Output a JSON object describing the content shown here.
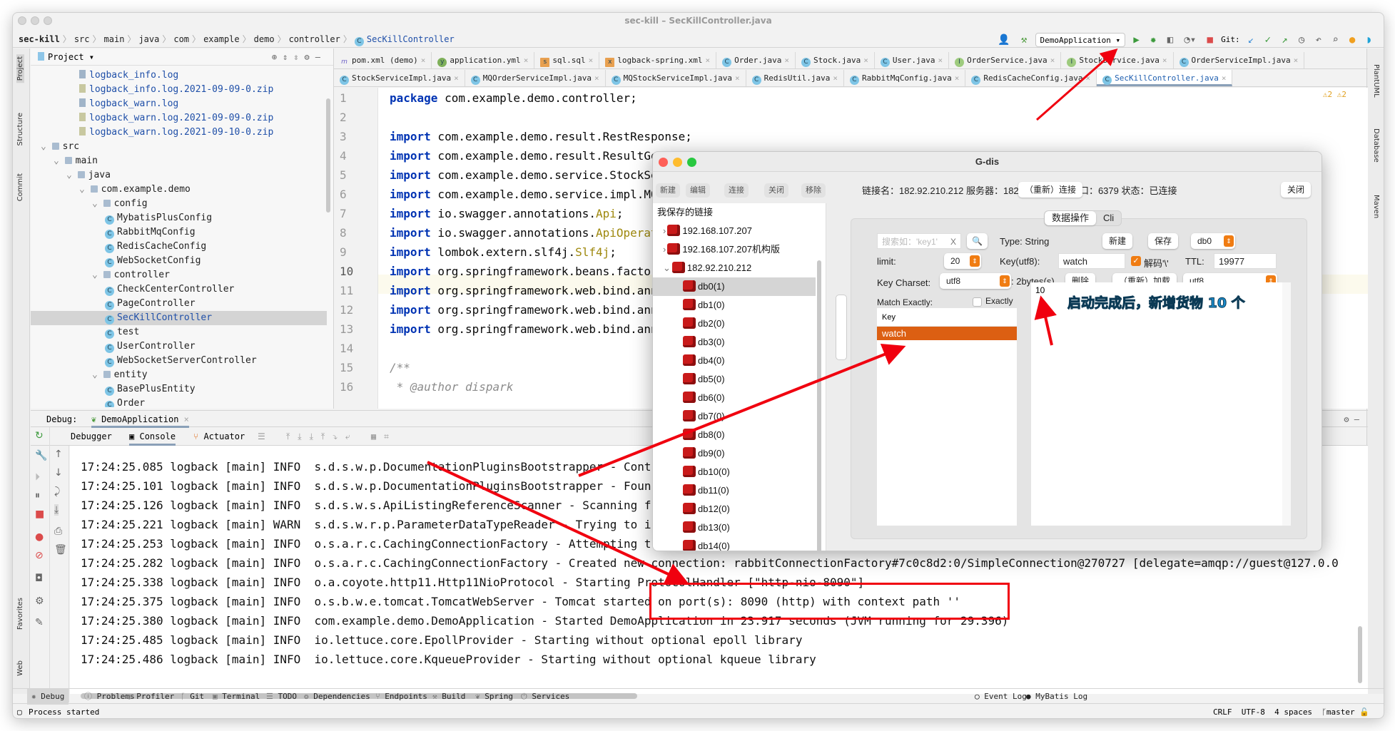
{
  "window": {
    "title": "sec-kill – SecKillController.java"
  },
  "breadcrumb": [
    "sec-kill",
    "src",
    "main",
    "java",
    "com",
    "example",
    "demo",
    "controller",
    "SecKillController"
  ],
  "toolbar": {
    "run_config": "DemoApplication",
    "git_label": "Git:"
  },
  "project": {
    "header": "Project",
    "tree": [
      {
        "label": "logback_info.log",
        "indent": 4,
        "type": "log",
        "link": true
      },
      {
        "label": "logback_info.log.2021-09-09-0.zip",
        "indent": 4,
        "type": "zip",
        "link": true
      },
      {
        "label": "logback_warn.log",
        "indent": 4,
        "type": "log",
        "link": true
      },
      {
        "label": "logback_warn.log.2021-09-09-0.zip",
        "indent": 4,
        "type": "zip",
        "link": true
      },
      {
        "label": "logback_warn.log.2021-09-10-0.zip",
        "indent": 4,
        "type": "zip",
        "link": true
      },
      {
        "label": "src",
        "indent": 1,
        "type": "folder",
        "arrow": "v"
      },
      {
        "label": "main",
        "indent": 2,
        "type": "folder",
        "arrow": "v"
      },
      {
        "label": "java",
        "indent": 3,
        "type": "folder",
        "arrow": "v"
      },
      {
        "label": "com.example.demo",
        "indent": 4,
        "type": "folder",
        "arrow": "v"
      },
      {
        "label": "config",
        "indent": 5,
        "type": "folder",
        "arrow": "v"
      },
      {
        "label": "MybatisPlusConfig",
        "indent": 6,
        "type": "class"
      },
      {
        "label": "RabbitMqConfig",
        "indent": 6,
        "type": "class"
      },
      {
        "label": "RedisCacheConfig",
        "indent": 6,
        "type": "class"
      },
      {
        "label": "WebSocketConfig",
        "indent": 6,
        "type": "class"
      },
      {
        "label": "controller",
        "indent": 5,
        "type": "folder",
        "arrow": "v"
      },
      {
        "label": "CheckCenterController",
        "indent": 6,
        "type": "class"
      },
      {
        "label": "PageController",
        "indent": 6,
        "type": "class"
      },
      {
        "label": "SecKillController",
        "indent": 6,
        "type": "class",
        "selected": true
      },
      {
        "label": "test",
        "indent": 6,
        "type": "class"
      },
      {
        "label": "UserController",
        "indent": 6,
        "type": "class"
      },
      {
        "label": "WebSocketServerController",
        "indent": 6,
        "type": "class"
      },
      {
        "label": "entity",
        "indent": 5,
        "type": "folder",
        "arrow": "v"
      },
      {
        "label": "BasePlusEntity",
        "indent": 6,
        "type": "class"
      },
      {
        "label": "Order",
        "indent": 6,
        "type": "class"
      }
    ]
  },
  "tabs_row1": [
    {
      "label": "pom.xml (demo)",
      "icon": "m"
    },
    {
      "label": "application.yml",
      "icon": "y"
    },
    {
      "label": "sql.sql",
      "icon": "s"
    },
    {
      "label": "logback-spring.xml",
      "icon": "x"
    },
    {
      "label": "Order.java",
      "icon": "C"
    },
    {
      "label": "Stock.java",
      "icon": "C"
    },
    {
      "label": "User.java",
      "icon": "C"
    },
    {
      "label": "OrderService.java",
      "icon": "I"
    },
    {
      "label": "StockService.java",
      "icon": "I"
    },
    {
      "label": "OrderServiceImpl.java",
      "icon": "C"
    }
  ],
  "tabs_row2": [
    {
      "label": "StockServiceImpl.java",
      "icon": "C"
    },
    {
      "label": "MQOrderServiceImpl.java",
      "icon": "C"
    },
    {
      "label": "MQStockServiceImpl.java",
      "icon": "C"
    },
    {
      "label": "RedisUtil.java",
      "icon": "C"
    },
    {
      "label": "RabbitMqConfig.java",
      "icon": "C"
    },
    {
      "label": "RedisCacheConfig.java",
      "icon": "C"
    },
    {
      "label": "SecKillController.java",
      "icon": "C",
      "active": true
    }
  ],
  "editor": {
    "warnings": "⚠2  ⚠2",
    "lines": [
      {
        "n": "1",
        "kw": "package",
        "rest": " com.example.demo.controller;"
      },
      {
        "n": "2",
        "kw": "",
        "rest": ""
      },
      {
        "n": "3",
        "kw": "import",
        "rest": " com.example.demo.result.RestResponse;"
      },
      {
        "n": "4",
        "kw": "import",
        "rest": " com.example.demo.result.ResultGen"
      },
      {
        "n": "5",
        "kw": "import",
        "rest": " com.example.demo.service.StockSer"
      },
      {
        "n": "6",
        "kw": "import",
        "rest": " com.example.demo.service.impl.MQS"
      },
      {
        "n": "7",
        "kw": "import",
        "rest": " io.swagger.annotations.",
        "ann": "Api",
        "tail": ";"
      },
      {
        "n": "8",
        "kw": "import",
        "rest": " io.swagger.annotations.",
        "ann": "ApiOperati"
      },
      {
        "n": "9",
        "kw": "import",
        "rest": " lombok.extern.slf4j.",
        "ann": "Slf4j",
        "tail": ";"
      },
      {
        "n": "10",
        "kw": "import",
        "rest": " org.springframework.beans.factory"
      },
      {
        "n": "11",
        "kw": "import",
        "rest": " org.springframework.web.bind.anno"
      },
      {
        "n": "12",
        "kw": "import",
        "rest": " org.springframework.web.bind.anno"
      },
      {
        "n": "13",
        "kw": "import",
        "rest": " org.springframework.web.bind.anno"
      },
      {
        "n": "14",
        "kw": "",
        "rest": ""
      },
      {
        "n": "15",
        "kw": "",
        "rest": "",
        "cmt": "/**"
      },
      {
        "n": "16",
        "kw": "",
        "rest": "",
        "cmt": " * @author dispark"
      }
    ]
  },
  "debug": {
    "label": "Debug:",
    "session": "DemoApplication",
    "tabs": [
      "Debugger",
      "Console",
      "Actuator"
    ]
  },
  "console": [
    "17:24:25.085 logback [main] INFO  s.d.s.w.p.DocumentationPluginsBootstrapper - Cont",
    "17:24:25.101 logback [main] INFO  s.d.s.w.p.DocumentationPluginsBootstrapper - Foun",
    "17:24:25.126 logback [main] INFO  s.d.s.w.s.ApiListingReferenceScanner - Scanning f",
    "17:24:25.221 logback [main] WARN  s.d.s.w.r.p.ParameterDataTypeReader - Trying to i",
    "17:24:25.253 logback [main] INFO  o.s.a.r.c.CachingConnectionFactory - Attempting t",
    "17:24:25.282 logback [main] INFO  o.s.a.r.c.CachingConnectionFactory - Created new connection: rabbitConnectionFactory#7c0c8d2:0/SimpleConnection@270727 [delegate=amqp://guest@127.0.0",
    "17:24:25.338 logback [main] INFO  o.a.coyote.http11.Http11NioProtocol - Starting ProtocolHandler [\"http-nio-8090\"]",
    "17:24:25.375 logback [main] INFO  o.s.b.w.e.tomcat.TomcatWebServer - Tomcat started on port(s): 8090 (http) with context path ''",
    "17:24:25.380 logback [main] INFO  com.example.demo.DemoApplication - Started DemoApplication in 23.917 seconds (JVM running for 29.396)",
    "17:24:25.485 logback [main] INFO  io.lettuce.core.EpollProvider - Starting without optional epoll library",
    "17:24:25.486 logback [main] INFO  io.lettuce.core.KqueueProvider - Starting without optional kqueue library"
  ],
  "bottom_tools": [
    "Debug",
    "Problems",
    "Profiler",
    "Git",
    "Terminal",
    "TODO",
    "Dependencies",
    "Endpoints",
    "Build",
    "Spring",
    "Services"
  ],
  "bottom_right": [
    "Event Log",
    "MyBatis Log"
  ],
  "status": {
    "message": "Process started",
    "line_sep": "CRLF",
    "encoding": "UTF-8",
    "indent": "4 spaces",
    "branch": "master"
  },
  "left_stripe": [
    "Project",
    "Structure",
    "Commit",
    "Favorites",
    "Web"
  ],
  "right_stripe": [
    "PlantUML",
    "Database",
    "Maven"
  ],
  "gdis": {
    "title": "G-dis",
    "buttons": [
      "新建",
      "编辑",
      "连接",
      "关闭",
      "移除"
    ],
    "saved_header": "我保存的链接",
    "connections": [
      {
        "label": "192.168.107.207",
        "arrow": ">"
      },
      {
        "label": "192.168.107.207机构版",
        "arrow": ">"
      },
      {
        "label": "182.92.210.212",
        "arrow": "v"
      }
    ],
    "dbs": [
      "db0(1)",
      "db1(0)",
      "db2(0)",
      "db3(0)",
      "db4(0)",
      "db5(0)",
      "db6(0)",
      "db7(0)",
      "db8(0)",
      "db9(0)",
      "db10(0)",
      "db11(0)",
      "db12(0)",
      "db13(0)",
      "db14(0)"
    ],
    "info": "链接名：182.92.210.212 服务器：182.92.210.212 端口：6379  状态：已连接",
    "reconnect": "（重新）连接",
    "close": "关闭",
    "tabs": [
      "数据操作",
      "Cli"
    ],
    "search_placeholder": "搜索如：'key1'",
    "clear": "X",
    "type_label": "Type: String",
    "new_btn": "新建",
    "save_btn": "保存",
    "db_select": "db0",
    "limit_label": "limit:",
    "limit_value": "20",
    "key_label": "Key(utf8):",
    "key_value": "watch",
    "decode_label": "解码'\\'",
    "ttl_label": "TTL:",
    "ttl_value": "19977",
    "charset_label": "Key Charset:",
    "charset_value": "utf8",
    "size_label": ": 2bytes(s)",
    "delete_btn": "删除",
    "reload_btn": "（重新）加载",
    "value_charset": "utf8",
    "match_label": "Match Exactly:",
    "exactly_label": "Exactly",
    "key_col": "Key",
    "keys": [
      "watch"
    ],
    "value": "10"
  },
  "annotation": "启动完成后，新增货物 10 个",
  "colors": {
    "accent": "#e0600f",
    "annotation_red": "#f0000f",
    "link": "#1f4fa8"
  }
}
